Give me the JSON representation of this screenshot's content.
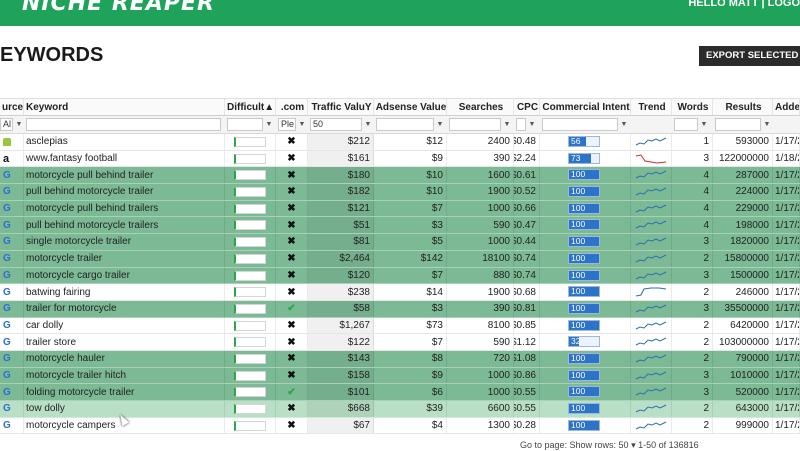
{
  "app": {
    "logo": "NICHE REAPER",
    "user_text": "HELLO MATT | LOGO"
  },
  "page": {
    "title": "EYWORDS",
    "export_label": "EXPORT SELECTED TO"
  },
  "columns": [
    {
      "key": "source",
      "label": "urce"
    },
    {
      "key": "keyword",
      "label": "Keyword"
    },
    {
      "key": "difficulty",
      "label": "Difficult▲"
    },
    {
      "key": "com",
      "label": ".com"
    },
    {
      "key": "traffic",
      "label": "Traffic ValuY"
    },
    {
      "key": "adsense",
      "label": "Adsense Value"
    },
    {
      "key": "searches",
      "label": "Searches"
    },
    {
      "key": "cpc",
      "label": "CPC"
    },
    {
      "key": "intent",
      "label": "Commercial Intent"
    },
    {
      "key": "trend",
      "label": "Trend"
    },
    {
      "key": "words",
      "label": "Words"
    },
    {
      "key": "results",
      "label": "Results"
    },
    {
      "key": "added",
      "label": "Adde"
    }
  ],
  "filters": {
    "source": "Al",
    "com": "Ple",
    "traffic": "50"
  },
  "rows": [
    {
      "style": "white",
      "src": "android",
      "kw": "asclepias",
      "com": "x",
      "traffic": "$212",
      "adsense": "$12",
      "searches": "2400",
      "cpc": "$0.48",
      "intent": 56,
      "intent_label": "56",
      "trend": "wave",
      "words": "1",
      "results": "593000",
      "added": "1/17/2"
    },
    {
      "style": "white",
      "src": "amazon",
      "kw": "www.fantasy football",
      "com": "x",
      "traffic": "$161",
      "adsense": "$9",
      "searches": "390",
      "cpc": "$2.24",
      "intent": 73,
      "intent_label": "73",
      "trend": "red",
      "words": "3",
      "results": "122000000",
      "added": "1/18/2"
    },
    {
      "style": "green",
      "src": "google",
      "kw": "motorcycle pull behind trailer",
      "com": "x",
      "traffic": "$180",
      "adsense": "$10",
      "searches": "1600",
      "cpc": "$0.61",
      "intent": 100,
      "intent_label": "100",
      "trend": "wave",
      "words": "4",
      "results": "287000",
      "added": "1/17/2"
    },
    {
      "style": "green",
      "src": "google",
      "kw": "pull behind motorcycle trailer",
      "com": "x",
      "traffic": "$182",
      "adsense": "$10",
      "searches": "1900",
      "cpc": "$0.52",
      "intent": 100,
      "intent_label": "100",
      "trend": "wave",
      "words": "4",
      "results": "224000",
      "added": "1/17/2"
    },
    {
      "style": "green",
      "src": "google",
      "kw": "motorcycle pull behind trailers",
      "com": "x",
      "traffic": "$121",
      "adsense": "$7",
      "searches": "1000",
      "cpc": "$0.66",
      "intent": 100,
      "intent_label": "100",
      "trend": "wave",
      "words": "4",
      "results": "229000",
      "added": "1/17/2"
    },
    {
      "style": "green",
      "src": "google",
      "kw": "pull behind motorcycle trailers",
      "com": "x",
      "traffic": "$51",
      "adsense": "$3",
      "searches": "590",
      "cpc": "$0.47",
      "intent": 100,
      "intent_label": "100",
      "trend": "wave",
      "words": "4",
      "results": "198000",
      "added": "1/17/2"
    },
    {
      "style": "green",
      "src": "google",
      "kw": "single motorcycle trailer",
      "com": "x",
      "traffic": "$81",
      "adsense": "$5",
      "searches": "1000",
      "cpc": "$0.44",
      "intent": 100,
      "intent_label": "100",
      "trend": "wave",
      "words": "3",
      "results": "1820000",
      "added": "1/17/2"
    },
    {
      "style": "green",
      "src": "google",
      "kw": "motorcycle trailer",
      "com": "x",
      "traffic": "$2,464",
      "adsense": "$142",
      "searches": "18100",
      "cpc": "$0.74",
      "intent": 100,
      "intent_label": "100",
      "trend": "wave",
      "words": "2",
      "results": "15800000",
      "added": "1/17/2"
    },
    {
      "style": "green",
      "src": "google",
      "kw": "motorcycle cargo trailer",
      "com": "x",
      "traffic": "$120",
      "adsense": "$7",
      "searches": "880",
      "cpc": "$0.74",
      "intent": 100,
      "intent_label": "100",
      "trend": "wave",
      "words": "3",
      "results": "1500000",
      "added": "1/17/2"
    },
    {
      "style": "white",
      "src": "google",
      "kw": "batwing fairing",
      "com": "x",
      "traffic": "$238",
      "adsense": "$14",
      "searches": "1900",
      "cpc": "$0.68",
      "intent": 100,
      "intent_label": "100",
      "trend": "step",
      "words": "2",
      "results": "246000",
      "added": "1/17/2"
    },
    {
      "style": "green",
      "src": "google",
      "kw": "trailer for motorcycle",
      "com": "check",
      "traffic": "$58",
      "adsense": "$3",
      "searches": "390",
      "cpc": "$0.81",
      "intent": 100,
      "intent_label": "100",
      "trend": "wave",
      "words": "3",
      "results": "35500000",
      "added": "1/17/2"
    },
    {
      "style": "white",
      "src": "google",
      "kw": "car dolly",
      "com": "x",
      "traffic": "$1,267",
      "adsense": "$73",
      "searches": "8100",
      "cpc": "$0.85",
      "intent": 100,
      "intent_label": "100",
      "trend": "wave",
      "words": "2",
      "results": "6420000",
      "added": "1/17/2"
    },
    {
      "style": "white",
      "src": "google",
      "kw": "trailer store",
      "com": "x",
      "traffic": "$122",
      "adsense": "$7",
      "searches": "590",
      "cpc": "$1.12",
      "intent": 32,
      "intent_label": "32",
      "trend": "wave",
      "words": "2",
      "results": "103000000",
      "added": "1/17/2"
    },
    {
      "style": "green",
      "src": "google",
      "kw": "motorcycle hauler",
      "com": "x",
      "traffic": "$143",
      "adsense": "$8",
      "searches": "720",
      "cpc": "$1.08",
      "intent": 100,
      "intent_label": "100",
      "trend": "wave",
      "words": "2",
      "results": "790000",
      "added": "1/17/2"
    },
    {
      "style": "green",
      "src": "google",
      "kw": "motorcycle trailer hitch",
      "com": "x",
      "traffic": "$158",
      "adsense": "$9",
      "searches": "1000",
      "cpc": "$0.86",
      "intent": 100,
      "intent_label": "100",
      "trend": "wave",
      "words": "3",
      "results": "1010000",
      "added": "1/17/2"
    },
    {
      "style": "green",
      "src": "google",
      "kw": "folding motorcycle trailer",
      "com": "check",
      "traffic": "$101",
      "adsense": "$6",
      "searches": "1000",
      "cpc": "$0.55",
      "intent": 100,
      "intent_label": "100",
      "trend": "wave",
      "words": "3",
      "results": "520000",
      "added": "1/17/2"
    },
    {
      "style": "light",
      "src": "google",
      "kw": "tow dolly",
      "com": "x",
      "traffic": "$668",
      "adsense": "$39",
      "searches": "6600",
      "cpc": "$0.55",
      "intent": 100,
      "intent_label": "100",
      "trend": "wave",
      "words": "2",
      "results": "643000",
      "added": "1/17/2"
    },
    {
      "style": "white",
      "src": "google",
      "kw": "motorcycle campers",
      "com": "x",
      "traffic": "$67",
      "adsense": "$4",
      "searches": "1300",
      "cpc": "$0.28",
      "intent": 100,
      "intent_label": "100",
      "trend": "wave",
      "words": "2",
      "results": "999000",
      "added": "1/17/2"
    }
  ],
  "footer": {
    "text": "Go to page:   Show rows: 50 ▾   1-50 of 136816"
  },
  "colors": {
    "brand": "#1fa35a",
    "row_green": "#7cb995",
    "intent_bar": "#2b74c9"
  }
}
